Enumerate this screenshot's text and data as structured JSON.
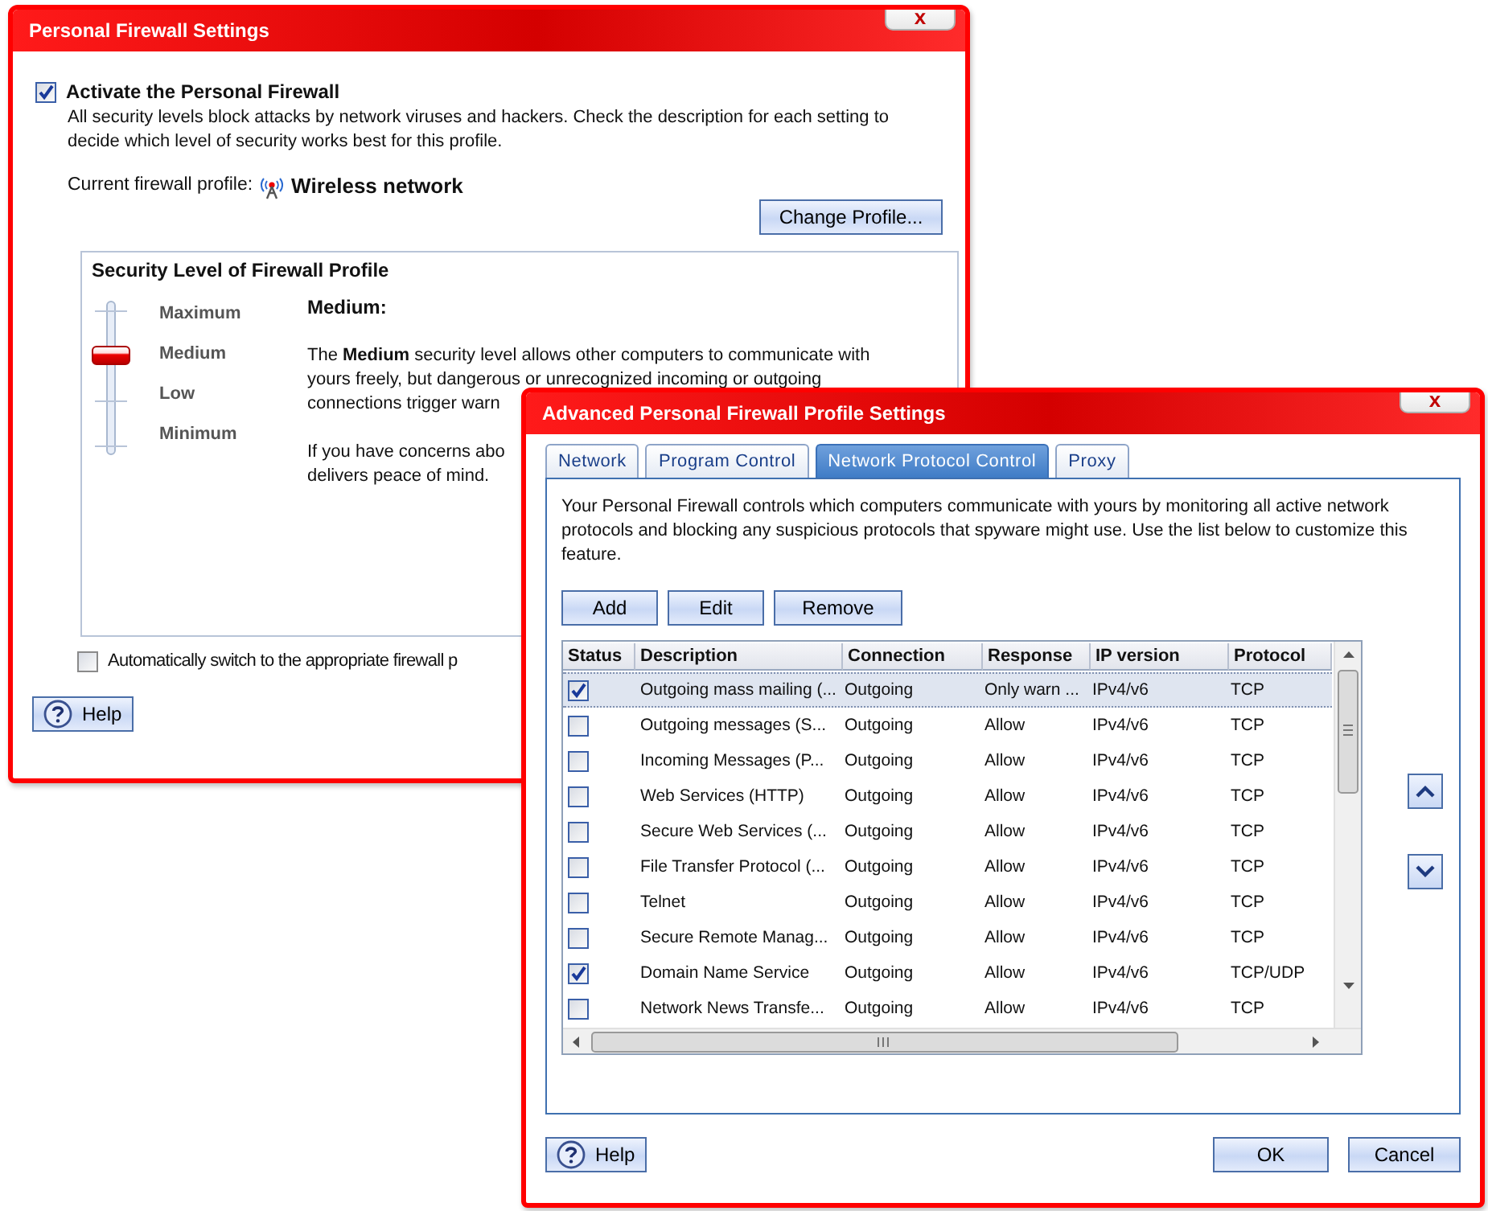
{
  "firewall_window": {
    "title": "Personal Firewall Settings",
    "close": "x",
    "activate": {
      "label": "Activate the Personal Firewall",
      "checked": true
    },
    "description": "All security levels block attacks by network viruses and hackers. Check the description for each setting to decide which level of security works best for this profile.",
    "profile_label": "Current firewall profile:",
    "profile_name": "Wireless network",
    "change_profile_button": "Change Profile...",
    "security_level": {
      "title": "Security Level of Firewall Profile",
      "levels": [
        "Maximum",
        "Medium",
        "Low",
        "Minimum"
      ],
      "level": 0.667,
      "heading": "Medium:",
      "description_lines": [
        "The **Medium** security level allows other computers to communicate with",
        "yours freely, but dangerous or unrecognized incoming or outgoing",
        "connections trigger warn"
      ],
      "note_lines": [
        "If you have concerns abo",
        "delivers peace of mind."
      ]
    },
    "auto_switch": {
      "label": "Automatically switch to the appropriate firewall p",
      "checked": false
    },
    "help_button": "Help"
  },
  "advanced_window": {
    "title": "Advanced Personal Firewall Profile Settings",
    "close": "x",
    "tabs": [
      {
        "label": "Network",
        "selected": false
      },
      {
        "label": "Program Control",
        "selected": false
      },
      {
        "label": "Network Protocol Control",
        "selected": true
      },
      {
        "label": "Proxy",
        "selected": false
      }
    ],
    "intro": "Your Personal Firewall controls which computers communicate with yours by monitoring all active network protocols and blocking any suspicious protocols that spyware might use. Use the list below to customize this feature.",
    "list_buttons": [
      "Add",
      "Edit",
      "Remove"
    ],
    "table": {
      "columns": [
        "Status",
        "Description",
        "Connection",
        "Response",
        "IP version",
        "Protocol"
      ],
      "rows": [
        {
          "checked": true,
          "selected": true,
          "description": "Outgoing mass mailing (...",
          "connection": "Outgoing",
          "response": "Only warn ...",
          "ip_version": "IPv4/v6",
          "protocol": "TCP"
        },
        {
          "checked": false,
          "selected": false,
          "description": "Outgoing messages (S...",
          "connection": "Outgoing",
          "response": "Allow",
          "ip_version": "IPv4/v6",
          "protocol": "TCP"
        },
        {
          "checked": false,
          "selected": false,
          "description": "Incoming Messages (P...",
          "connection": "Outgoing",
          "response": "Allow",
          "ip_version": "IPv4/v6",
          "protocol": "TCP"
        },
        {
          "checked": false,
          "selected": false,
          "description": "Web Services (HTTP)",
          "connection": "Outgoing",
          "response": "Allow",
          "ip_version": "IPv4/v6",
          "protocol": "TCP"
        },
        {
          "checked": false,
          "selected": false,
          "description": "Secure Web Services (...",
          "connection": "Outgoing",
          "response": "Allow",
          "ip_version": "IPv4/v6",
          "protocol": "TCP"
        },
        {
          "checked": false,
          "selected": false,
          "description": "File Transfer Protocol (...",
          "connection": "Outgoing",
          "response": "Allow",
          "ip_version": "IPv4/v6",
          "protocol": "TCP"
        },
        {
          "checked": false,
          "selected": false,
          "description": "Telnet",
          "connection": "Outgoing",
          "response": "Allow",
          "ip_version": "IPv4/v6",
          "protocol": "TCP"
        },
        {
          "checked": false,
          "selected": false,
          "description": "Secure Remote Manag...",
          "connection": "Outgoing",
          "response": "Allow",
          "ip_version": "IPv4/v6",
          "protocol": "TCP"
        },
        {
          "checked": true,
          "selected": false,
          "description": "Domain Name Service",
          "connection": "Outgoing",
          "response": "Allow",
          "ip_version": "IPv4/v6",
          "protocol": "TCP/UDP"
        },
        {
          "checked": false,
          "selected": false,
          "description": "Network News Transfe...",
          "connection": "Outgoing",
          "response": "Allow",
          "ip_version": "IPv4/v6",
          "protocol": "TCP"
        }
      ]
    },
    "help_button": "Help",
    "ok_button": "OK",
    "cancel_button": "Cancel"
  }
}
